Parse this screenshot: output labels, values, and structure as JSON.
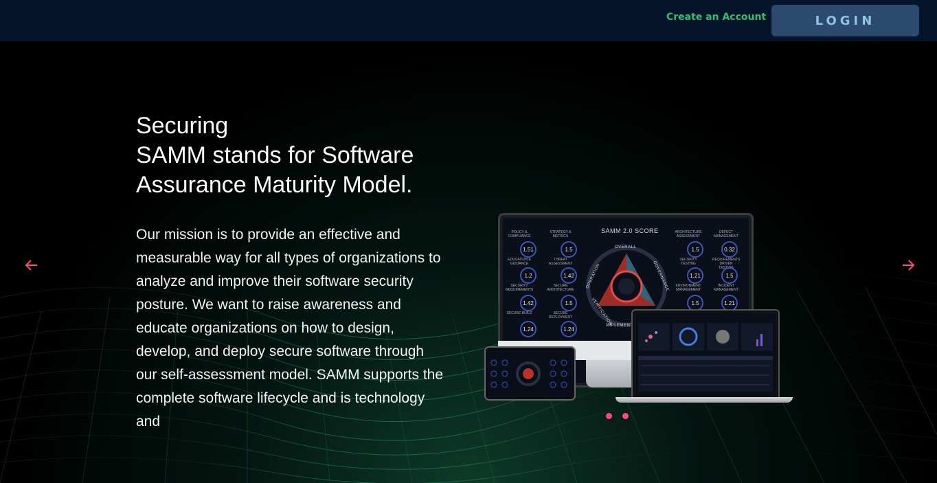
{
  "header": {
    "create_account": "Create an Account",
    "login": "LOGIN"
  },
  "hero": {
    "title_line1": "Securing",
    "title_line2": "SAMM stands for Software",
    "title_line3": "Assurance Maturity Model.",
    "description": "Our mission is to provide an effective and measurable way for all types of organizations to analyze and improve their software security posture. We want to raise awareness and educate organizations on how to design, develop, and deploy secure software through our self-assessment model. SAMM supports the complete software lifecycle and is technology and"
  },
  "mockup": {
    "score_title": "SAMM 2.0 SCORE",
    "left_scores": [
      {
        "label": "POLICY & COMPLIANCE",
        "value": "1.51"
      },
      {
        "label": "STRATEGY & METRICS",
        "value": "1.5"
      },
      {
        "label": "EDUCATION & GUIDANCE",
        "value": "1.2"
      },
      {
        "label": "THREAT ASSESSMENT",
        "value": "1.42"
      },
      {
        "label": "SECURITY REQUIREMENTS",
        "value": "1.42"
      },
      {
        "label": "SECURE ARCHITECTURE",
        "value": "1.5"
      },
      {
        "label": "SECURE BUILD",
        "value": "1.24"
      },
      {
        "label": "SECURE DEPLOYMENT",
        "value": "1.24"
      }
    ],
    "right_scores": [
      {
        "label": "ARCHITECTURE ASSESSMENT",
        "value": "1.5"
      },
      {
        "label": "DEFECT MANAGEMENT",
        "value": "0.32"
      },
      {
        "label": "SECURITY TESTING",
        "value": "1.21"
      },
      {
        "label": "REQUIREMENTS DRIVEN TESTING",
        "value": "1.5"
      },
      {
        "label": "ENVIRONMENT MANAGEMENT",
        "value": "1.5"
      },
      {
        "label": "INCIDENT MANAGEMENT",
        "value": "1.21"
      }
    ],
    "ring_labels": {
      "overall": "OVERALL",
      "operation": "OPERATION",
      "governance": "GOVERNANCE",
      "verification": "VERIFICATION",
      "implementation": "IMPLEMENTATION"
    }
  },
  "carousel": {
    "prev_icon": "arrow-left-icon",
    "next_icon": "arrow-right-icon",
    "dot_count": 2
  },
  "colors": {
    "accent": "#ff4b7b",
    "create_link": "#2fbf74",
    "login_bg": "#2c4a6e",
    "header_bg": "#04142a"
  }
}
